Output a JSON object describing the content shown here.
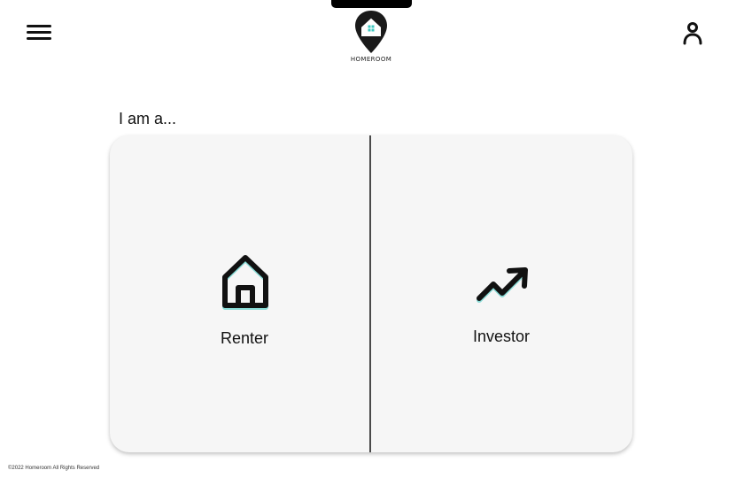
{
  "header": {
    "logo_text": "HOMEROOM",
    "menu_icon": "hamburger-menu-icon",
    "profile_icon": "user-profile-icon"
  },
  "main": {
    "prompt": "I am a...",
    "options": [
      {
        "label": "Renter",
        "icon": "house-icon"
      },
      {
        "label": "Investor",
        "icon": "trending-up-icon"
      }
    ]
  },
  "footer": {
    "copyright": "©2022 Homeroom All Rights Reserved"
  },
  "colors": {
    "accent": "#3ec8c0",
    "text": "#111111",
    "card_background": "#f6f6f6"
  }
}
